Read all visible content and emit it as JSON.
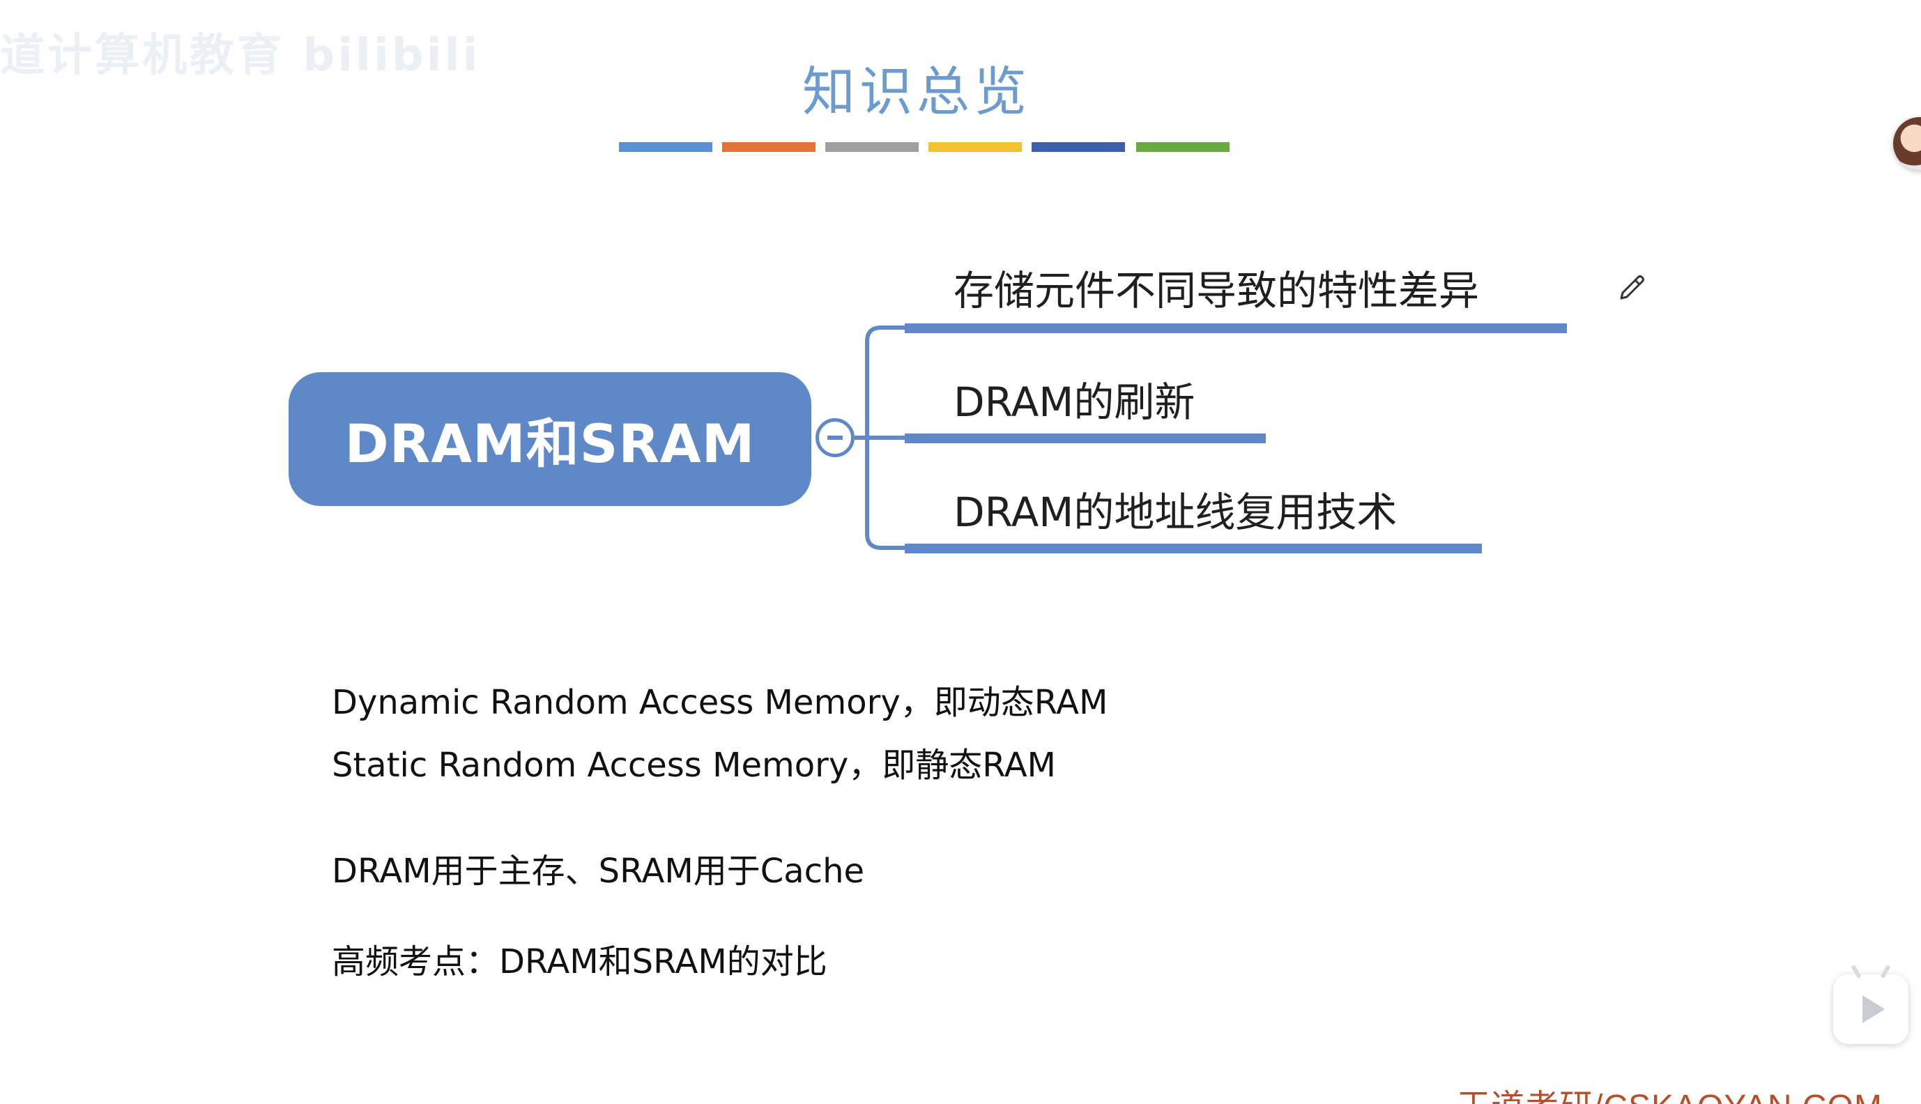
{
  "watermark": "道计算机教育 bilibili",
  "title": "知识总览",
  "color_bars": [
    "#5a8fd0",
    "#e07335",
    "#a0a0a0",
    "#f1c232",
    "#3d5fa8",
    "#6aaa45"
  ],
  "accent_color": "#5f88c8",
  "mindmap": {
    "root": "DRAM和SRAM",
    "branches": [
      {
        "label": "存储元件不同导致的特性差异"
      },
      {
        "label": "DRAM的刷新"
      },
      {
        "label": "DRAM的地址线复用技术"
      }
    ]
  },
  "notes": {
    "dram_def": "Dynamic Random Access Memory，即动态RAM",
    "sram_def": "Static Random Access Memory，即静态RAM",
    "usage": "DRAM用于主存、SRAM用于Cache",
    "key_point": "高频考点：DRAM和SRAM的对比"
  },
  "footer": "王道考研/CSKAOYAN.COM",
  "icons": {
    "edit": "pencil-icon",
    "collapse": "collapse-icon",
    "play": "play-icon"
  }
}
